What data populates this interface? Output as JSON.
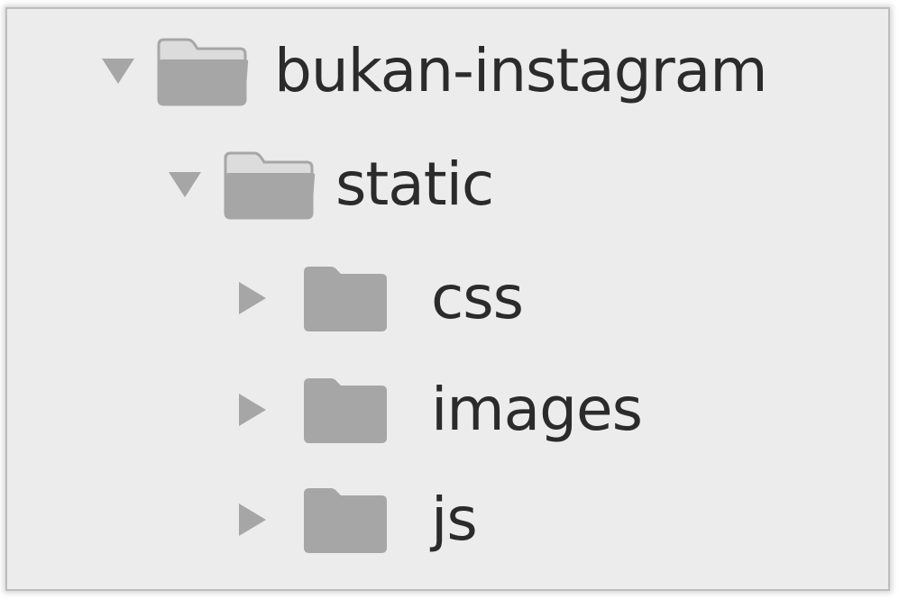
{
  "tree": {
    "items": [
      {
        "label": "bukan-instagram",
        "expanded": true,
        "icon": "folder-open-icon",
        "twisty": "triangle-down-icon"
      },
      {
        "label": "static",
        "expanded": true,
        "icon": "folder-open-icon",
        "twisty": "triangle-down-icon"
      },
      {
        "label": "css",
        "expanded": false,
        "icon": "folder-closed-icon",
        "twisty": "triangle-right-icon"
      },
      {
        "label": "images",
        "expanded": false,
        "icon": "folder-closed-icon",
        "twisty": "triangle-right-icon"
      },
      {
        "label": "js",
        "expanded": false,
        "icon": "folder-closed-icon",
        "twisty": "triangle-right-icon"
      }
    ]
  },
  "colors": {
    "panel_background": "#ececec",
    "icon_gray": "#a6a6a6",
    "text": "#2b2b2b"
  }
}
